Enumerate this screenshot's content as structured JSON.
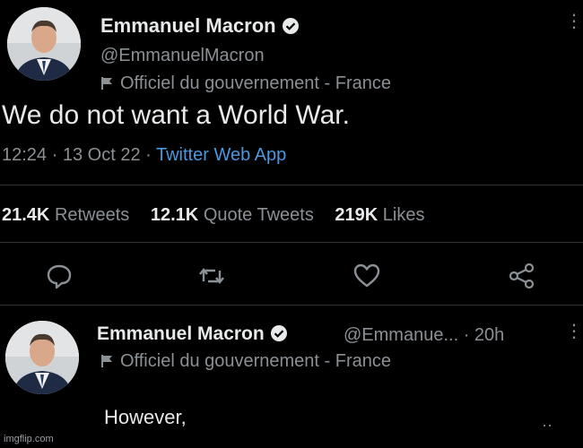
{
  "main_tweet": {
    "author_name": "Emmanuel Macron",
    "handle": "@EmmanuelMacron",
    "label": "Officiel du gouvernement - France",
    "text": "We do not want a World War.",
    "time": "12:24",
    "date": "13 Oct 22",
    "app": "Twitter Web App",
    "stats": {
      "retweets_count": "21.4K",
      "retweets_label": "Retweets",
      "quotes_count": "12.1K",
      "quotes_label": "Quote Tweets",
      "likes_count": "219K",
      "likes_label": "Likes"
    },
    "actions": [
      "reply-icon",
      "retweet-icon",
      "like-icon",
      "share-icon"
    ]
  },
  "reply_tweet": {
    "author_name": "Emmanuel Macron",
    "handle": "@Emmanue...",
    "age": "20h",
    "label": "Officiel du gouvernement - France",
    "text": "However,"
  },
  "watermark": "imgflip.com",
  "colors": {
    "background": "#000000",
    "primary_text": "#e7e9ea",
    "secondary_text": "#8b9095",
    "link": "#4a98e0",
    "divider": "#2f3336"
  }
}
